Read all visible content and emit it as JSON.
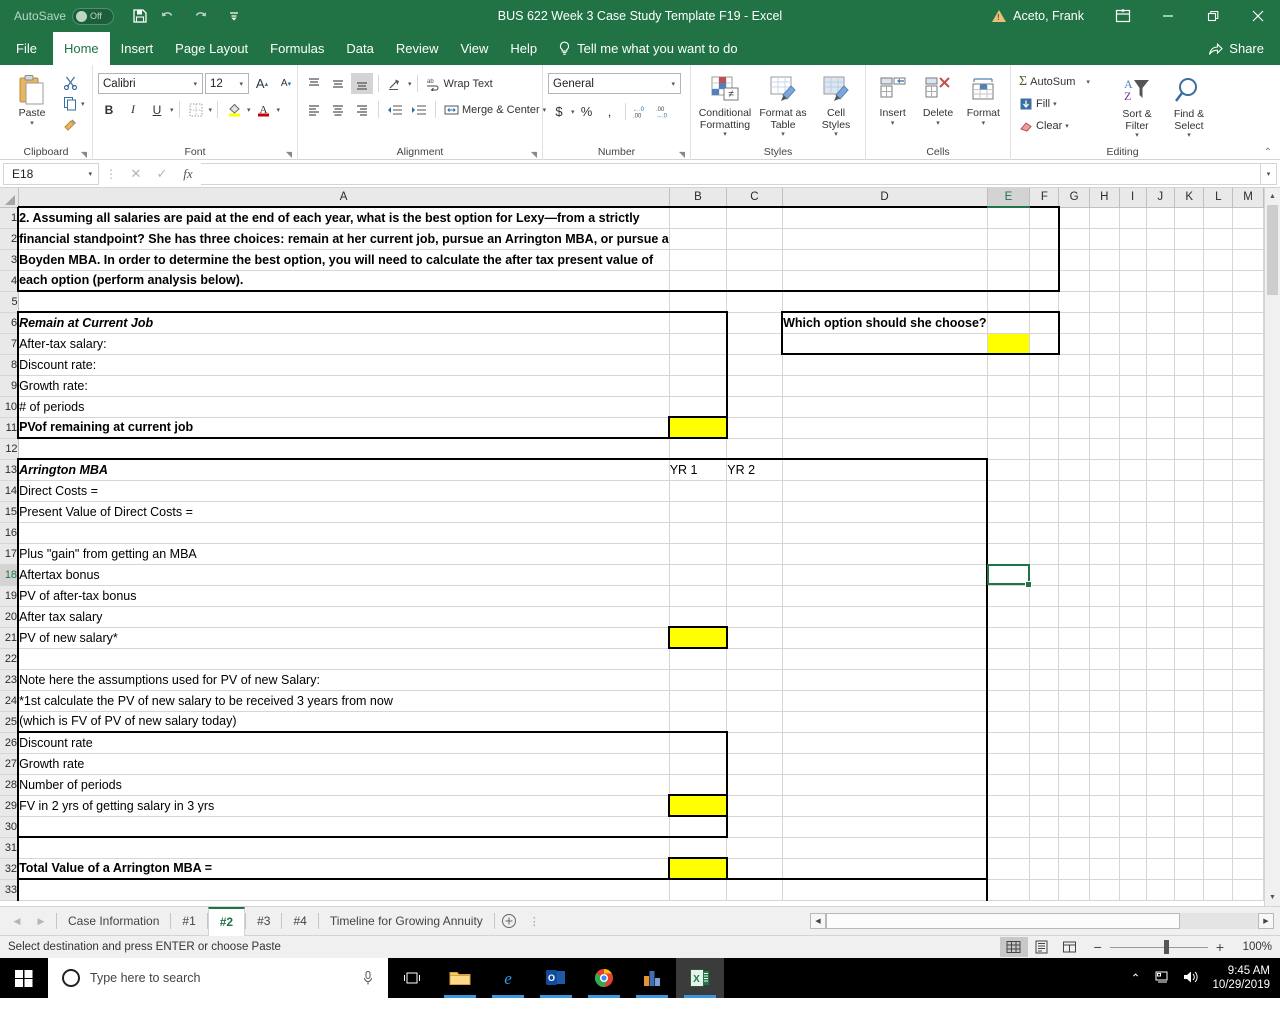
{
  "titlebar": {
    "autosave_label": "AutoSave",
    "autosave_state": "Off",
    "document_title": "BUS 622 Week 3 Case Study Template F19  -  Excel",
    "account_name": "Aceto, Frank",
    "qat": [
      "save-icon",
      "undo-icon",
      "redo-icon",
      "customize-qat-icon"
    ],
    "window_buttons": [
      "ribbon-display-options",
      "minimize",
      "restore",
      "close"
    ]
  },
  "menu": {
    "tabs": [
      "File",
      "Home",
      "Insert",
      "Page Layout",
      "Formulas",
      "Data",
      "Review",
      "View",
      "Help"
    ],
    "active_tab": "Home",
    "tell_me": "Tell me what you want to do",
    "share": "Share"
  },
  "ribbon": {
    "groups": [
      {
        "name": "Clipboard",
        "label": "Clipboard"
      },
      {
        "name": "Font",
        "label": "Font"
      },
      {
        "name": "Alignment",
        "label": "Alignment"
      },
      {
        "name": "Number",
        "label": "Number"
      },
      {
        "name": "Styles",
        "label": "Styles"
      },
      {
        "name": "Cells",
        "label": "Cells"
      },
      {
        "name": "Editing",
        "label": "Editing"
      }
    ],
    "clipboard": {
      "paste": "Paste",
      "cut": "cut-icon",
      "copy": "copy-icon",
      "format_painter": "format-painter-icon"
    },
    "font": {
      "font_name": "Calibri",
      "font_size": "12",
      "grow": "A",
      "shrink": "A",
      "bold": "B",
      "italic": "I",
      "underline": "U",
      "borders": "borders-icon",
      "fill_color": "fill-color-icon",
      "font_color": "font-color-icon"
    },
    "alignment": {
      "wrap_text": "Wrap Text",
      "merge_center": "Merge & Center"
    },
    "number": {
      "format": "General",
      "currency": "$",
      "percent": "%",
      "comma": ",",
      "increase_decimal": "increase-decimal-icon",
      "decrease_decimal": "decrease-decimal-icon"
    },
    "styles": {
      "conditional_formatting": "Conditional Formatting",
      "format_as_table": "Format as Table",
      "cell_styles": "Cell Styles"
    },
    "cells": {
      "insert": "Insert",
      "delete": "Delete",
      "format": "Format"
    },
    "editing": {
      "autosum": "AutoSum",
      "fill": "Fill",
      "clear": "Clear",
      "sort_filter": "Sort & Filter",
      "find_select": "Find & Select"
    }
  },
  "formulabar": {
    "namebox": "E18",
    "cancel": "cancel-icon",
    "enter": "enter-icon",
    "insert_function": "fx",
    "value": ""
  },
  "grid": {
    "columns": [
      "A",
      "B",
      "C",
      "D",
      "E",
      "F",
      "G",
      "H",
      "I",
      "J",
      "K",
      "L",
      "M"
    ],
    "selected_column": "E",
    "selected_cell": "E18",
    "rows": [
      1,
      2,
      3,
      4,
      5,
      6,
      7,
      8,
      9,
      10,
      11,
      12,
      13,
      14,
      15,
      16,
      17,
      18,
      19,
      20,
      21,
      22,
      23,
      24,
      25,
      26,
      27,
      28,
      29,
      30,
      31,
      32,
      33
    ],
    "cells": {
      "A1": "2. Assuming all salaries are paid at the end of each year, what is the best option for Lexy—from a strictly",
      "A2": "financial standpoint? She has three choices: remain at her current job, pursue an Arrington MBA, or pursue a",
      "A3": "Boyden MBA.  In order to determine the best option, you will need to calculate the after tax present value of",
      "A4": "each option (perform analysis below).",
      "A6": "Remain at Current Job",
      "D6": "Which option should she choose?",
      "A7": "After-tax salary:",
      "A8": "Discount rate:",
      "A9": "Growth rate:",
      "A10": "# of periods",
      "A11": "PVof remaining at current job",
      "A13": "Arrington MBA",
      "B13": "YR 1",
      "C13": "YR 2",
      "A14": "Direct Costs =",
      "A15": "Present Value of Direct Costs =",
      "A17": "Plus \"gain\" from getting an MBA",
      "A18": "Aftertax bonus",
      "A19": "PV of after-tax bonus",
      "A20": "After tax salary",
      "A21": "PV of new salary*",
      "A23": "Note here the assumptions used for PV of new Salary:",
      "A24": "*1st calculate the PV of new salary to be received 3 years from now",
      "A25": "(which is FV of PV of new salary today)",
      "A26": "Discount rate",
      "A27": "Growth rate",
      "A28": "Number of periods",
      "A29": "FV in 2 yrs of getting salary in 3 yrs",
      "A32": "Total Value of a Arrington MBA ="
    },
    "highlight_color": "#ffff00",
    "selection_color": "#217346"
  },
  "sheettabs": {
    "tabs": [
      "Case Information",
      "#1",
      "#2",
      "#3",
      "#4",
      "Timeline for Growing Annuity"
    ],
    "active": "#2",
    "add_label": "+"
  },
  "statusbar": {
    "message": "Select destination and press ENTER or choose Paste",
    "views": [
      "normal-view",
      "page-layout-view",
      "page-break-preview"
    ],
    "active_view": "normal-view",
    "zoom_out": "−",
    "zoom_in": "+",
    "zoom_level": "100%"
  },
  "taskbar": {
    "search_placeholder": "Type here to search",
    "icons": [
      "task-view-icon",
      "file-explorer-icon",
      "internet-explorer-icon",
      "outlook-icon",
      "chrome-icon",
      "app-icon",
      "excel-icon"
    ],
    "time": "9:45 AM",
    "date": "10/29/2019"
  }
}
